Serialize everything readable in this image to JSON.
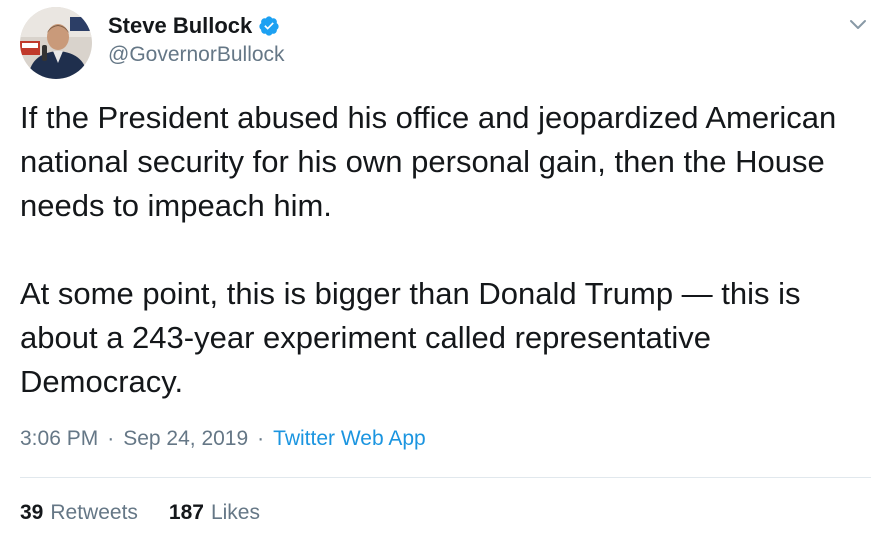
{
  "author": {
    "display_name": "Steve Bullock",
    "handle": "@GovernorBullock",
    "verified": true,
    "avatar_icon": "profile-photo"
  },
  "tweet": {
    "paragraphs": [
      "If the President abused his office and jeopardized American national security for his own personal gain, then the House needs to impeach him.",
      "At some point, this is bigger than Donald Trump — this is about a 243-year experiment called representative Democracy."
    ],
    "time": "3:06 PM",
    "separator": "·",
    "date": "Sep 24, 2019",
    "source": "Twitter Web App"
  },
  "stats": {
    "retweets_count": "39",
    "retweets_label": "Retweets",
    "likes_count": "187",
    "likes_label": "Likes"
  },
  "colors": {
    "text": "#14171a",
    "secondary": "#657786",
    "link": "#1b95e0",
    "verified": "#1da1f2",
    "divider": "#e1e8ed"
  },
  "icons": {
    "verified": "verified-badge-icon",
    "menu": "chevron-down-icon"
  }
}
